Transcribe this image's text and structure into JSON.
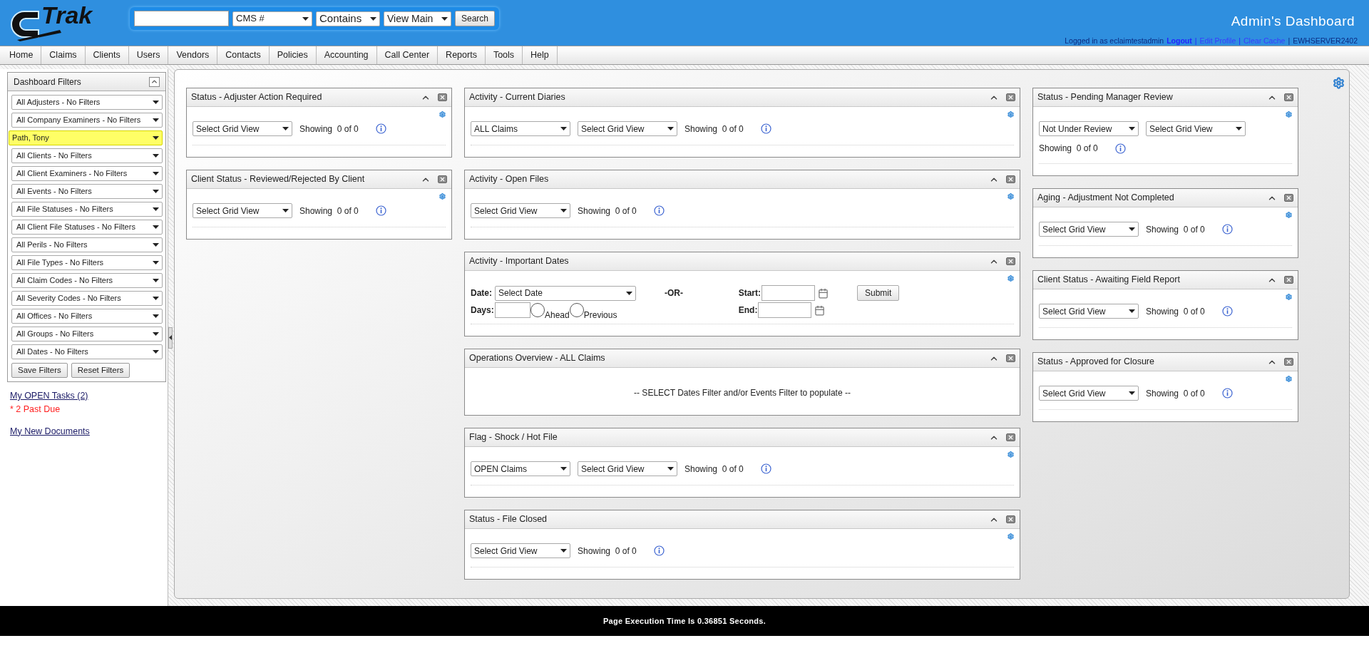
{
  "header": {
    "logo_text": "Trak",
    "search": {
      "search_by": "CMS #",
      "match": "Contains",
      "view": "View Main",
      "button": "Search"
    },
    "title": "Admin's Dashboard",
    "user_line": {
      "prefix": "Logged in as eclaimtestadmin",
      "logout": "Logout",
      "edit_profile": "Edit Profile",
      "clear_cache": "Clear Cache",
      "server": "EWHSERVER2402",
      "separators": [
        "|",
        "|",
        "|"
      ]
    }
  },
  "nav": [
    "Home",
    "Claims",
    "Clients",
    "Users",
    "Vendors",
    "Contacts",
    "Policies",
    "Accounting",
    "Call Center",
    "Reports",
    "Tools",
    "Help"
  ],
  "sidebar": {
    "title": "Dashboard Filters",
    "filters": [
      {
        "label": "All Adjusters - No Filters",
        "highlighted": false
      },
      {
        "label": "All Company Examiners - No Filters",
        "highlighted": false
      },
      {
        "label": "Path, Tony",
        "highlighted": true
      },
      {
        "label": "All Clients - No Filters",
        "highlighted": false
      },
      {
        "label": "All Client Examiners - No Filters",
        "highlighted": false
      },
      {
        "label": "All Events - No Filters",
        "highlighted": false
      },
      {
        "label": "All File Statuses - No Filters",
        "highlighted": false
      },
      {
        "label": "All Client File Statuses - No Filters",
        "highlighted": false
      },
      {
        "label": "All Perils - No Filters",
        "highlighted": false
      },
      {
        "label": "All File Types - No Filters",
        "highlighted": false
      },
      {
        "label": "All Claim Codes - No Filters",
        "highlighted": false
      },
      {
        "label": "All Severity Codes - No Filters",
        "highlighted": false
      },
      {
        "label": "All Offices - No Filters",
        "highlighted": false
      },
      {
        "label": "All Groups - No Filters",
        "highlighted": false
      },
      {
        "label": "All Dates - No Filters",
        "highlighted": false
      }
    ],
    "buttons": [
      "Save Filters",
      "Reset Filters"
    ],
    "tasks_link": "My OPEN Tasks (2)",
    "past_due": "* 2 Past Due",
    "documents_link": "My New Documents"
  },
  "columns": [
    [
      {
        "title": "Status - Adjuster Action Required",
        "kind": "grid",
        "grid_view": "Select Grid View",
        "showing": "Showing  0 of 0"
      },
      {
        "title": "Client Status - Reviewed/Rejected By Client",
        "kind": "grid",
        "grid_view": "Select Grid View",
        "showing": "Showing  0 of 0"
      }
    ],
    [
      {
        "title": "Activity - Current Diaries",
        "kind": "grid",
        "filter": "ALL Claims",
        "grid_view": "Select Grid View",
        "showing": "Showing  0 of 0"
      },
      {
        "title": "Activity - Open Files",
        "kind": "grid",
        "grid_view": "Select Grid View",
        "showing": "Showing  0 of 0"
      },
      {
        "title": "Activity - Important Dates",
        "kind": "dates",
        "date_label": "Date:",
        "date_select": "Select Date",
        "or": "-OR-",
        "start_label": "Start:",
        "submit": "Submit",
        "days_label": "Days:",
        "options": [
          {
            "label": "Ahead",
            "selected": false
          },
          {
            "label": "Previous",
            "selected": false
          }
        ],
        "end_label": "End:"
      },
      {
        "title": "Operations Overview - ALL Claims",
        "kind": "message",
        "message": "-- SELECT Dates Filter and/or Events Filter to populate --"
      },
      {
        "title": "Flag - Shock / Hot File",
        "kind": "grid",
        "filter": "OPEN Claims",
        "grid_view": "Select Grid View",
        "showing": "Showing  0 of 0"
      },
      {
        "title": "Status - File Closed",
        "kind": "grid",
        "grid_view": "Select Grid View",
        "showing": "Showing  0 of 0"
      }
    ],
    [
      {
        "title": "Status - Pending Manager Review",
        "kind": "grid",
        "filter": "Not Under Review",
        "grid_view": "Select Grid View",
        "showing": "Showing  0 of 0"
      },
      {
        "title": "Aging - Adjustment Not Completed",
        "kind": "grid",
        "grid_view": "Select Grid View",
        "showing": "Showing  0 of 0"
      },
      {
        "title": "Client Status - Awaiting Field Report",
        "kind": "grid",
        "grid_view": "Select Grid View",
        "showing": "Showing  0 of 0"
      },
      {
        "title": "Status - Approved for Closure",
        "kind": "grid",
        "grid_view": "Select Grid View",
        "showing": "Showing  0 of 0"
      }
    ]
  ],
  "footer": "Page Execution Time Is 0.36851 Seconds."
}
